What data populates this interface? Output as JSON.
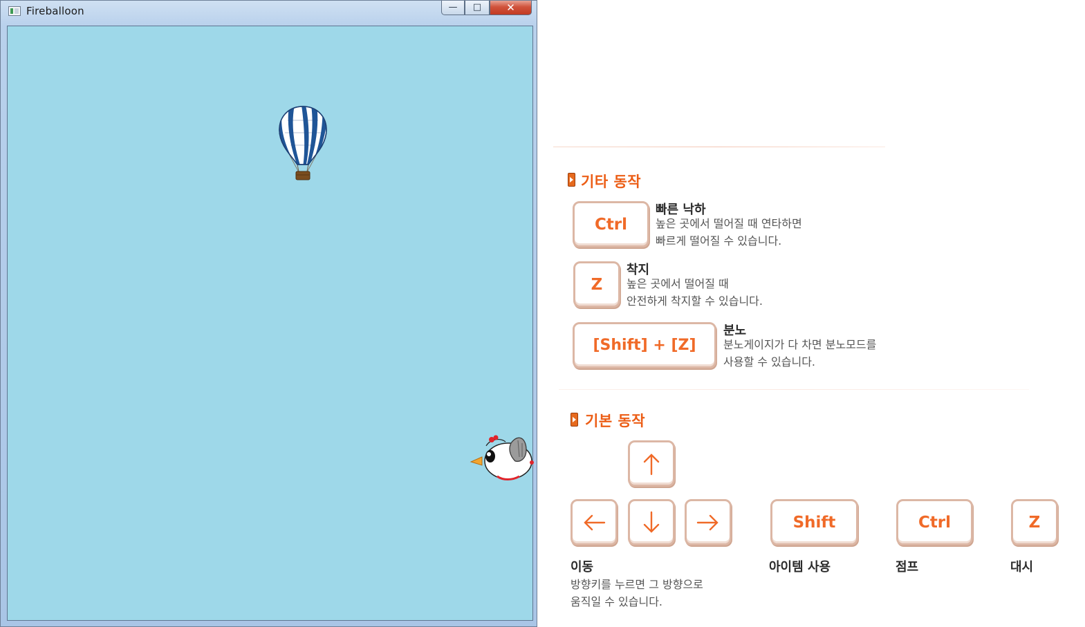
{
  "window": {
    "title": "Fireballoon",
    "controls": {
      "minimize": "—",
      "maximize": "□",
      "close": "✕"
    }
  },
  "scene": {
    "background_color": "#9ed8e9",
    "sprites": [
      "hot-air-balloon",
      "chicken"
    ]
  },
  "manual": {
    "other_actions": {
      "title": "기타 동작",
      "items": [
        {
          "key": "Ctrl",
          "title": "빠른 낙하",
          "desc_lines": [
            "높은 곳에서 떨어질 때 연타하면",
            "빠르게 떨어질 수 있습니다."
          ]
        },
        {
          "key": "Z",
          "title": "착지",
          "desc_lines": [
            "높은 곳에서 떨어질 때",
            "안전하게 착지할 수 있습니다."
          ]
        },
        {
          "key": "[Shift] + [Z]",
          "title": "분노",
          "desc_lines": [
            "분노게이지가 다 차면 분노모드를",
            "사용할 수 있습니다."
          ]
        }
      ]
    },
    "basic_actions": {
      "title": "기본 동작",
      "move": {
        "label": "이동",
        "desc_lines": [
          "방향키를 누르면 그 방향으로",
          "움직일 수 있습니다."
        ],
        "arrow_icons": [
          "up",
          "left",
          "down",
          "right"
        ]
      },
      "keys": [
        {
          "key": "Shift",
          "label": "아이템 사용"
        },
        {
          "key": "Ctrl",
          "label": "점프"
        },
        {
          "key": "Z",
          "label": "대시"
        }
      ]
    },
    "colors": {
      "accent": "#ec5d15",
      "key_border": "#dcb7a5",
      "key_text": "#f06a28"
    }
  }
}
